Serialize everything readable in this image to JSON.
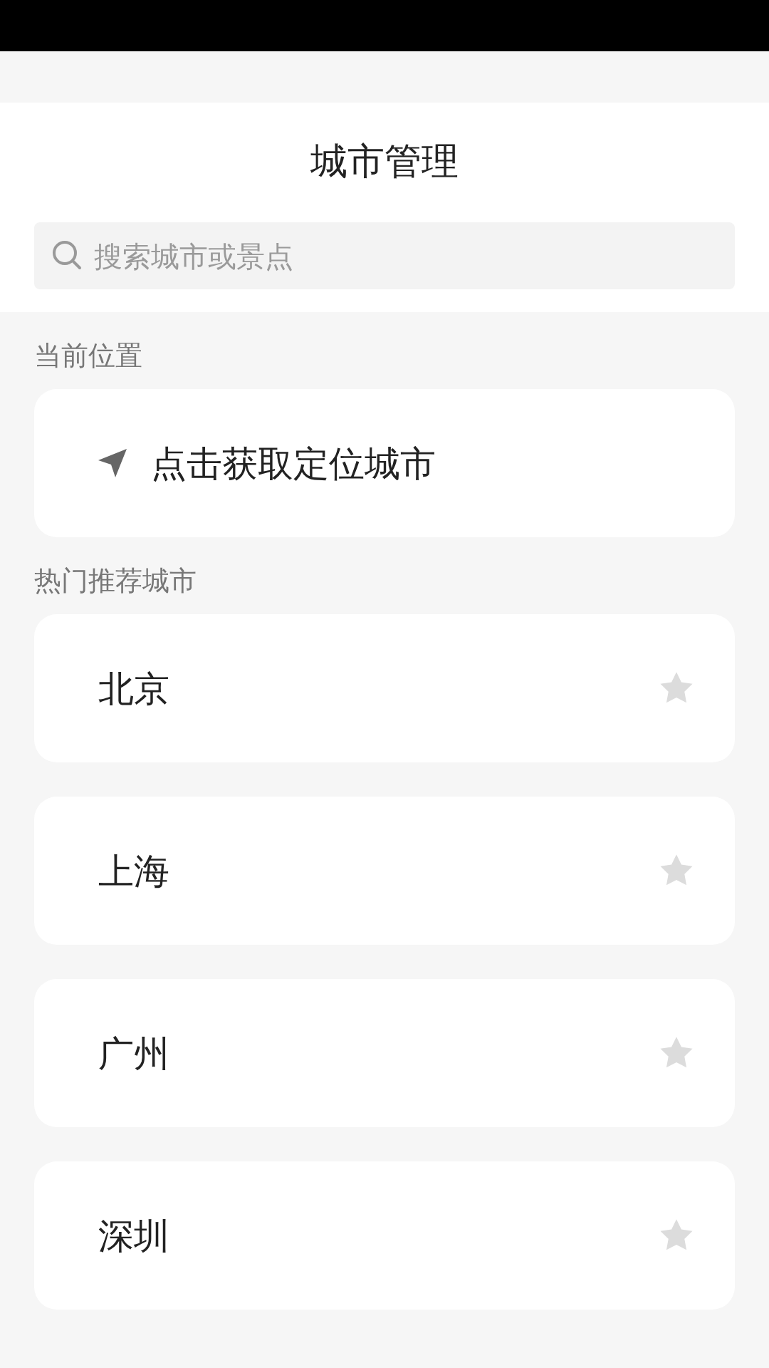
{
  "header": {
    "title": "城市管理"
  },
  "search": {
    "placeholder": "搜索城市或景点"
  },
  "current_location": {
    "label": "当前位置",
    "action": "点击获取定位城市"
  },
  "hot_cities": {
    "label": "热门推荐城市",
    "items": [
      {
        "name": "北京",
        "favorite": false
      },
      {
        "name": "上海",
        "favorite": false
      },
      {
        "name": "广州",
        "favorite": false
      },
      {
        "name": "深圳",
        "favorite": false
      }
    ]
  }
}
